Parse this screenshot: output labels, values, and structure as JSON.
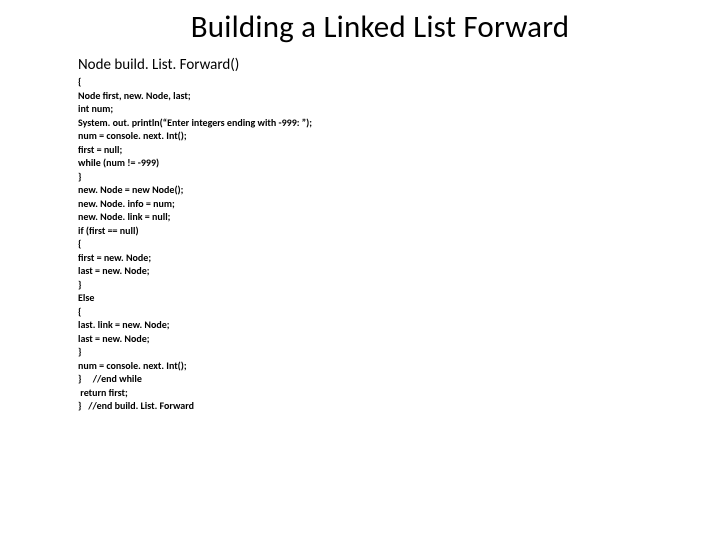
{
  "title": "Building a Linked List Forward",
  "signature": "Node build. List. Forward()",
  "code": [
    "{",
    "Node first, new. Node, last;",
    "int num;",
    "System. out. println(“Enter integers ending with -999: ”);",
    "num = console. next. Int();",
    "first = null;",
    "while (num != -999)",
    "}",
    "new. Node = new Node();",
    "new. Node. info = num;",
    "new. Node. link = null;",
    "if (first == null)",
    "{",
    "first = new. Node;",
    "last = new. Node;",
    "}",
    "Else",
    "{",
    "last. link = new. Node;",
    "last = new. Node;",
    "}",
    "num = console. next. Int();",
    "}     //end while",
    " return first;",
    "}   //end build. List. Forward"
  ]
}
